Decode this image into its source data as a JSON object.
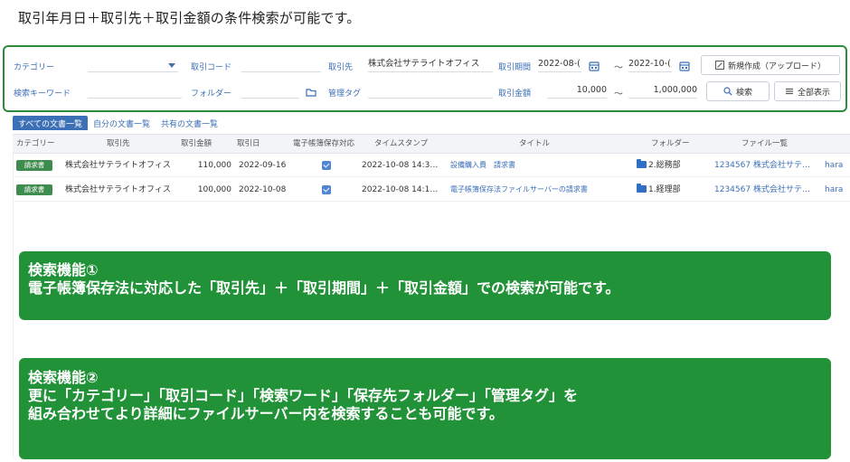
{
  "headline": "取引年月日＋取引先＋取引金額の条件検索が可能です。",
  "search": {
    "category_label": "カテゴリー",
    "category_value": "",
    "code_label": "取引コード",
    "code_value": "",
    "partner_label": "取引先",
    "partner_value": "株式会社サテライトオフィス",
    "period_label": "取引期間",
    "period_from": "2022-08-(",
    "period_tilde": "〜",
    "period_to": "2022-10-(",
    "keyword_label": "検索キーワード",
    "keyword_value": "",
    "folder_label": "フォルダー",
    "folder_value": "",
    "tag_label": "管理タグ",
    "tag_value": "",
    "amount_label": "取引金額",
    "amount_from": "10,000",
    "amount_tilde": "〜",
    "amount_to": "1,000,000",
    "new_button": "新規作成（アップロード）",
    "search_button": "検索",
    "showall_button": "全部表示"
  },
  "tabs": [
    "すべての文書一覧",
    "自分の文書一覧",
    "共有の文書一覧"
  ],
  "table": {
    "headers": [
      "カテゴリー",
      "取引先",
      "取引金額",
      "取引日",
      "電子帳簿保存対応",
      "タイムスタンプ",
      "タイトル",
      "フォルダー",
      "ファイル一覧"
    ],
    "rows": [
      {
        "category": "請求書",
        "partner": "株式会社サテライトオフィス",
        "amount": "110,000",
        "date": "2022-09-16",
        "timestamp": "2022-10-08 14:3…",
        "title": "設備購入費　請求書",
        "folder": "2.総務部",
        "file": "1234567 株式会社サテ…",
        "extra": "hara"
      },
      {
        "category": "請求書",
        "partner": "株式会社サテライトオフィス",
        "amount": "100,000",
        "date": "2022-10-08",
        "timestamp": "2022-10-08 14:1…",
        "title": "電子帳簿保存法ファイルサーバーの請求書",
        "folder": "1.経理部",
        "file": "1234567 株式会社サテ…",
        "extra": "hara"
      }
    ]
  },
  "callouts": [
    {
      "line1": "検索機能①",
      "line2": "電子帳簿保存法に対応した「取引先」＋「取引期間」＋「取引金額」での検索が可能です。",
      "line3": ""
    },
    {
      "line1": "検索機能②",
      "line2": "更に「カテゴリー」「取引コード」「検索ワード」「保存先フォルダー」「管理タグ」を",
      "line3": "組み合わせてより詳細にファイルサーバー内を検索することも可能です。"
    }
  ],
  "colors": {
    "accent": "#3b6fb6",
    "green": "#229239",
    "panel_border": "#2e8b3e"
  }
}
